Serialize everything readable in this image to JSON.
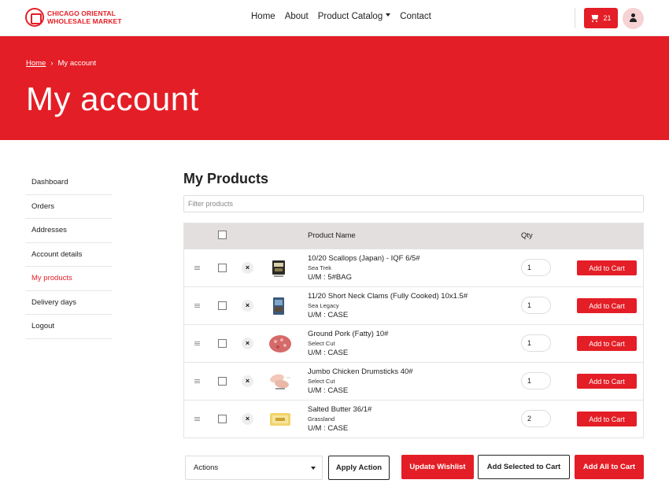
{
  "brand": {
    "line1": "CHICAGO ORIENTAL",
    "line2": "WHOLESALE MARKET",
    "logo_icon": "seal-logo-icon",
    "color": "#e41e26"
  },
  "nav": {
    "home": "Home",
    "about": "About",
    "catalog": "Product Catalog",
    "contact": "Contact"
  },
  "cart": {
    "count": "21",
    "icon": "cart-icon"
  },
  "user": {
    "icon": "user-icon"
  },
  "hero": {
    "breadcrumb_home": "Home",
    "breadcrumb_sep": "›",
    "breadcrumb_current": "My account",
    "title": "My account"
  },
  "sidebar": {
    "items": [
      {
        "label": "Dashboard"
      },
      {
        "label": "Orders"
      },
      {
        "label": "Addresses"
      },
      {
        "label": "Account details"
      },
      {
        "label": "My products"
      },
      {
        "label": "Delivery days"
      },
      {
        "label": "Logout"
      }
    ],
    "active": "My products"
  },
  "main": {
    "title": "My Products",
    "filter_placeholder": "Filter products",
    "columns": {
      "name": "Product Name",
      "qty": "Qty"
    },
    "remove_symbol": "×",
    "add_label": "Add to Cart",
    "rows": [
      {
        "name": "10/20 Scallops (Japan) - IQF 6/5#",
        "brand": "Sea Trek",
        "um": "U/M : 5#BAG",
        "qty": "1",
        "thumb": "scallops-package-image"
      },
      {
        "name": "11/20 Short Neck Clams (Fully Cooked) 10x1.5#",
        "brand": "Sea Legacy",
        "um": "U/M : CASE",
        "qty": "1",
        "thumb": "clams-package-image"
      },
      {
        "name": "Ground Pork (Fatty) 10#",
        "brand": "Select Cut",
        "um": "U/M : CASE",
        "qty": "1",
        "thumb": "ground-pork-image"
      },
      {
        "name": "Jumbo Chicken Drumsticks 40#",
        "brand": "Select Cut",
        "um": "U/M : CASE",
        "qty": "1",
        "thumb": "chicken-drumsticks-image"
      },
      {
        "name": "Salted Butter 36/1#",
        "brand": "Grassland",
        "um": "U/M : CASE",
        "qty": "2",
        "thumb": "butter-package-image"
      }
    ]
  },
  "footer": {
    "actions_select": "Actions",
    "apply": "Apply Action",
    "update": "Update Wishlist",
    "add_selected": "Add Selected to Cart",
    "add_all": "Add All to Cart"
  }
}
